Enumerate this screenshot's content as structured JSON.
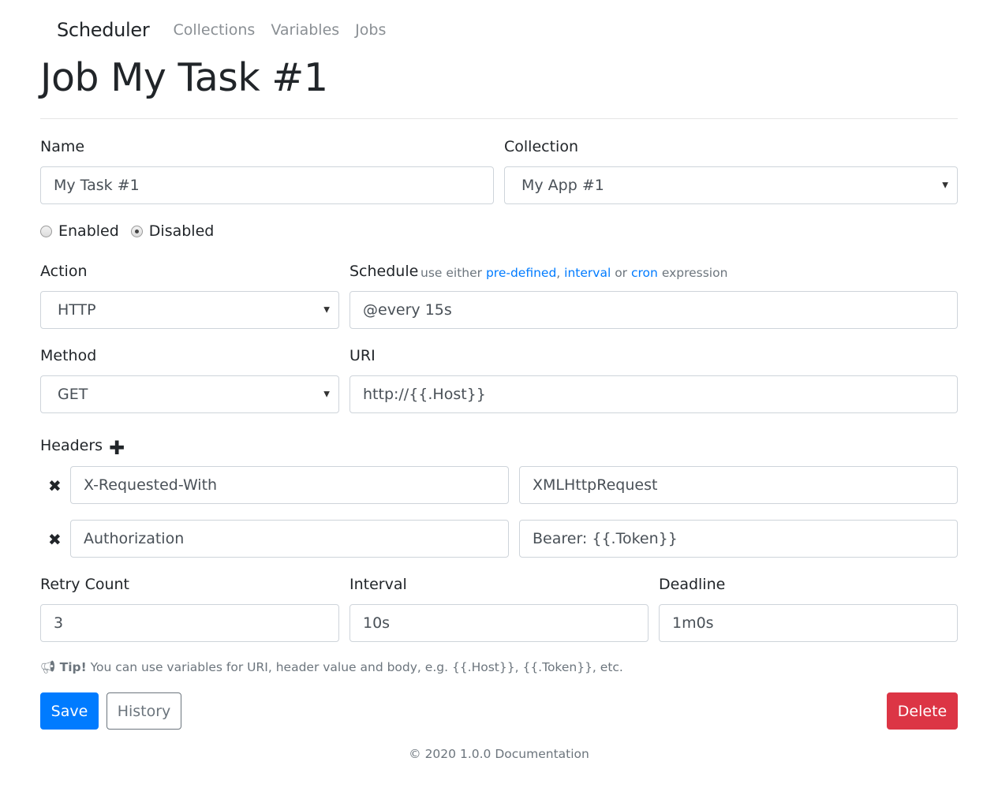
{
  "navbar": {
    "brand": "Scheduler",
    "links": [
      "Collections",
      "Variables",
      "Jobs"
    ]
  },
  "page": {
    "title": "Job My Task #1"
  },
  "form": {
    "name": {
      "label": "Name",
      "value": "My Task #1"
    },
    "collection": {
      "label": "Collection",
      "value": "My App #1"
    },
    "status": {
      "options": [
        "Enabled",
        "Disabled"
      ],
      "selected": "Disabled"
    },
    "action": {
      "label": "Action",
      "value": "HTTP"
    },
    "schedule": {
      "label": "Schedule",
      "help_prefix": "use either",
      "help_link_1": "pre-defined",
      "help_sep": ",",
      "help_link_2": "interval",
      "help_or": "or",
      "help_link_3": "cron",
      "help_suffix": "expression",
      "value": "@every 15s"
    },
    "method": {
      "label": "Method",
      "value": "GET"
    },
    "uri": {
      "label": "URI",
      "value": "http://{{.Host}}"
    },
    "headers": {
      "label": "Headers",
      "add_icon": "plus-icon",
      "remove_icon": "times-icon",
      "rows": [
        {
          "key": "X-Requested-With",
          "value": "XMLHttpRequest"
        },
        {
          "key": "Authorization",
          "value": "Bearer: {{.Token}}"
        }
      ]
    },
    "retry_count": {
      "label": "Retry Count",
      "value": "3"
    },
    "interval": {
      "label": "Interval",
      "value": "10s"
    },
    "deadline": {
      "label": "Deadline",
      "value": "1m0s"
    },
    "tip": {
      "icon": "bullhorn-icon",
      "bold": "Tip!",
      "text": "You can use variables for URI, header value and body, e.g. {{.Host}}, {{.Token}}, etc."
    }
  },
  "buttons": {
    "save": "Save",
    "history": "History",
    "delete": "Delete"
  },
  "footer": {
    "copyright": "© 2020",
    "version": "1.0.0",
    "docs": "Documentation"
  },
  "colors": {
    "primary": "#007bff",
    "danger": "#dc3545",
    "muted": "#6c757d"
  }
}
